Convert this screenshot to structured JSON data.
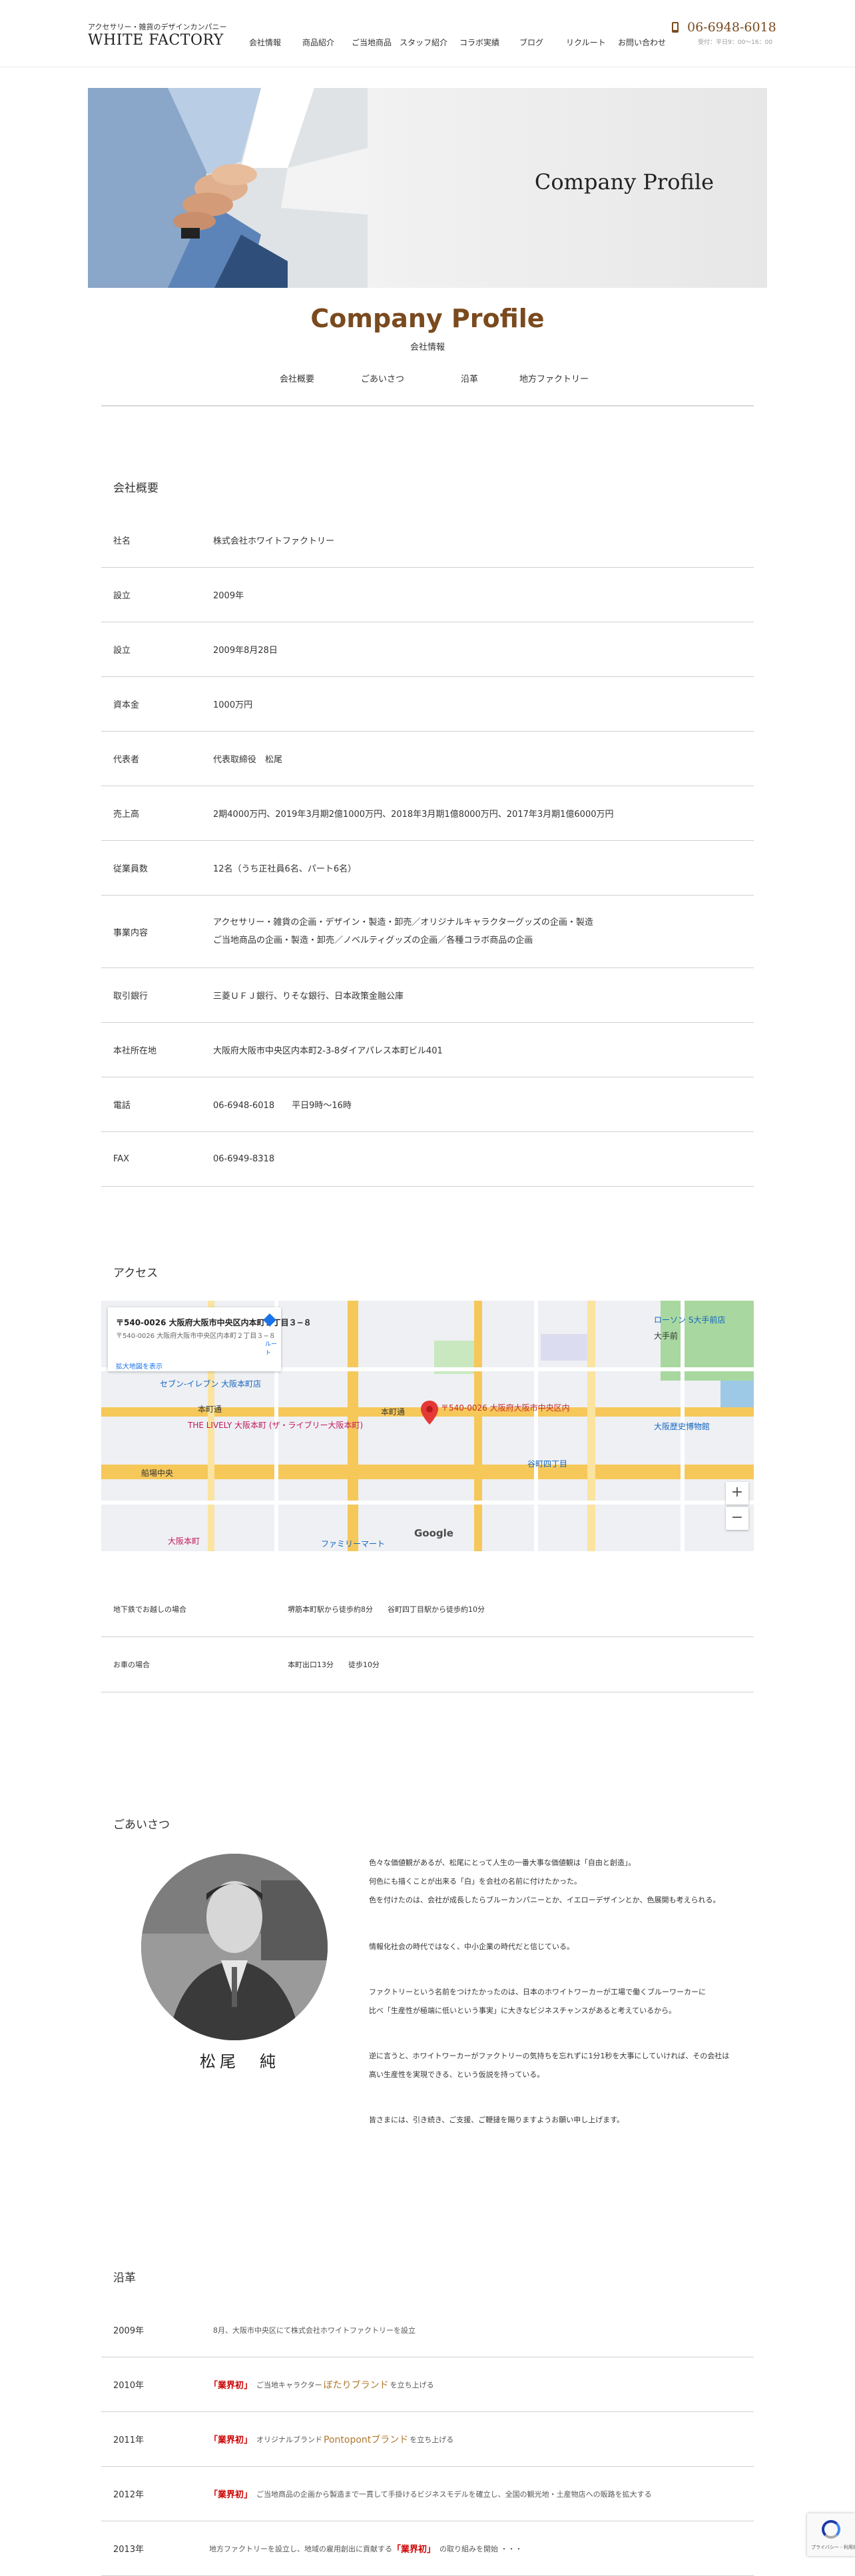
{
  "header": {
    "tagline": "アクセサリー・雑貨のデザインカンパニー",
    "logo": "WHITE FACTORY",
    "nav": [
      "会社情報",
      "商品紹介",
      "ご当地商品",
      "スタッフ紹介",
      "コラボ実績",
      "ブログ",
      "リクルート",
      "お問い合わせ"
    ],
    "phone": "06-6948-6018",
    "phone_hours": "受付：平日9：00～16：00"
  },
  "hero": {
    "title": "Company Profile"
  },
  "page": {
    "title": "Company Profile",
    "subtitle": "会社情報",
    "subnav": [
      "会社概要",
      "ごあいさつ",
      "沿革",
      "地方ファクトリー"
    ]
  },
  "overview": {
    "heading": "会社概要",
    "rows": [
      {
        "label": "社名",
        "value": "株式会社ホワイトファクトリー"
      },
      {
        "label": "設立",
        "value": "2009年"
      },
      {
        "label": "設立",
        "value": "2009年8月28日"
      },
      {
        "label": "資本金",
        "value": "1000万円"
      },
      {
        "label": "代表者",
        "value": "代表取締役　松尾"
      },
      {
        "label": "売上高",
        "value": "2期4000万円、2019年3月期2億1000万円、2018年3月期1億8000万円、2017年3月期1億6000万円"
      },
      {
        "label": "従業員数",
        "value": "12名（うち正社員6名、パート6名）"
      },
      {
        "label": "事業内容",
        "value": [
          "アクセサリー・雑貨の企画・デザイン・製造・卸売／オリジナルキャラクターグッズの企画・製造",
          "ご当地商品の企画・製造・卸売／ノベルティグッズの企画／各種コラボ商品の企画"
        ]
      },
      {
        "label": "取引銀行",
        "value": "三菱ＵＦＪ銀行、りそな銀行、日本政策金融公庫"
      },
      {
        "label": "本社所在地",
        "value": "大阪府大阪市中央区内本町2-3-8ダイアパレス本町ビル401"
      },
      {
        "label": "電話",
        "value": "06-6948-6018　　平日9時～16時"
      },
      {
        "label": "FAX",
        "value": "06-6949-8318"
      }
    ]
  },
  "access": {
    "heading": "アクセス",
    "map": {
      "card_title": "〒540-0026 大阪府大阪市中央区内本町２丁目３−８",
      "card_address": "〒540-0026 大阪府大阪市中央区内本町２丁目３−８",
      "card_link": "拡大地図を表示",
      "card_dir": "ルート",
      "marker_label": "〒540-0026 大阪府大阪市中央区内",
      "labels": [
        "本町通",
        "本町通",
        "船場中央",
        "大阪本町",
        "谷町四丁目",
        "セブン-イレブン 大阪本町店",
        "ローソン S大手前店",
        "大阪歴史博物館",
        "大手前",
        "THE LIVELY 大阪本町 (ザ・ライブリー大阪本町)",
        "ファミリーマート"
      ],
      "zoom_in": "+",
      "zoom_out": "−",
      "google": "Google"
    },
    "rows": [
      {
        "label": "地下鉄でお越しの場合",
        "value": "堺筋本町駅から徒歩約8分　　谷町四丁目駅から徒歩約10分"
      },
      {
        "label": "お車の場合",
        "value": "本町出口13分　　徒歩10分"
      }
    ]
  },
  "greeting": {
    "heading": "ごあいさつ",
    "name": "松尾　純",
    "paragraphs": [
      [
        "色々な価値観があるが、松尾にとって人生の一番大事な価値観は「自由と創造」。",
        "何色にも描くことが出来る「白」を会社の名前に付けたかった。",
        "色を付けたのは、会社が成長したらブルーカンパニーとか、イエローデザインとか、色展開も考えられる。"
      ],
      [
        "情報化社会の時代ではなく、中小企業の時代だと信じている。"
      ],
      [
        "ファクトリーという名前をつけたかったのは、日本のホワイトワーカーが工場で働くブルーワーカーに",
        "比べ「生産性が極端に低いという事実」に大きなビジネスチャンスがあると考えているから。"
      ],
      [
        "逆に言うと、ホワイトワーカーがファクトリーの気持ちを忘れずに1分1秒を大事にしていければ、その会社は",
        "高い生産性を実現できる、という仮説を持っている。"
      ],
      [
        "皆さまには、引き続き、ご支援、ご鞭撻を賜りますようお願い申し上げます。"
      ]
    ]
  },
  "history": {
    "heading": "沿革",
    "rows": [
      {
        "year": "2009年",
        "prefix": "",
        "text": "8月、大阪市中央区にて株式会社ホワイトファクトリーを設立",
        "brand": "",
        "suffix": ""
      },
      {
        "year": "2010年",
        "prefix": "「業界初」",
        "text": "ご当地キャラクター",
        "brand": "ぼたりブランド",
        "suffix": "を立ち上げる"
      },
      {
        "year": "2011年",
        "prefix": "「業界初」",
        "text": "オリジナルブランド",
        "brand": "Pontopontブランド",
        "suffix": "を立ち上げる"
      },
      {
        "year": "2012年",
        "prefix": "「業界初」",
        "text": "ご当地商品の企画から製造まで一貫して手掛けるビジネスモデルを確立し、全国の観光地・土産物店への販路を拡大する",
        "brand": "",
        "suffix": ""
      },
      {
        "year": "2013年",
        "prefix": "",
        "text": "地方ファクトリーを設立し、地域の雇用創出に貢献する",
        "brand": "「業界初」",
        "suffix": "の取り組みを開始 ・・・"
      }
    ]
  },
  "recaptcha": {
    "label": "プライバシー - 利用規約"
  },
  "colors": {
    "brand": "#7a4a1e",
    "accent_red": "#cc0000",
    "line": "#d0d0d0"
  }
}
